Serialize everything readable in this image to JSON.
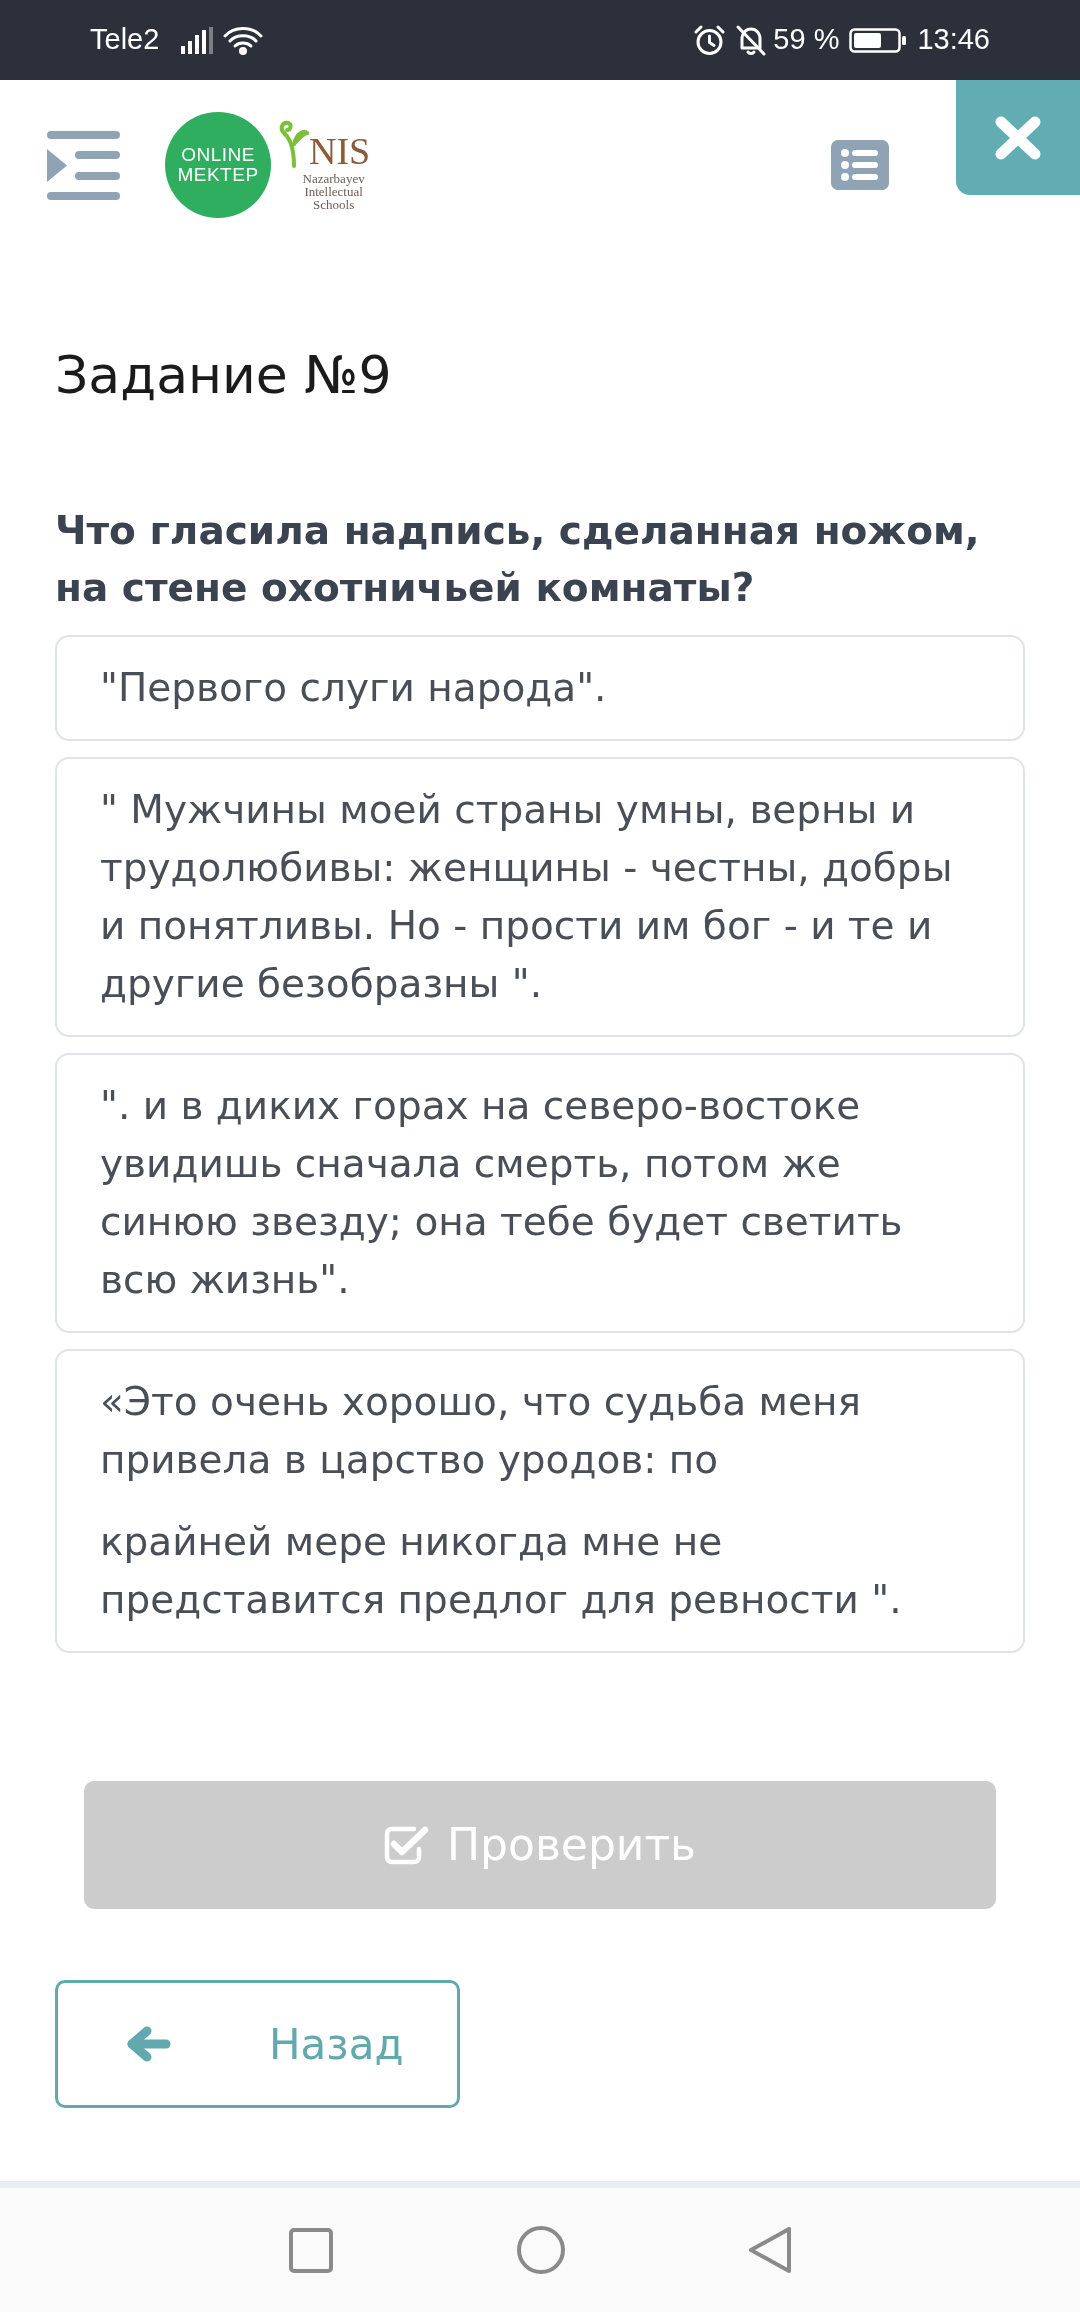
{
  "status_bar": {
    "carrier": "Tele2",
    "battery": "59 %",
    "time": "13:46"
  },
  "header": {
    "app_logo": {
      "lines": [
        "ONLINE",
        "MEKTEP"
      ]
    },
    "school_logo": {
      "mark": "NIS",
      "caption": [
        "Nazarbayev",
        "Intellectual",
        "Schools"
      ]
    }
  },
  "task": {
    "title": "Задание №9",
    "question": "Что гласила надпись, сделанная ножом, на стене охотничьей комнаты?",
    "options": [
      {
        "paragraphs": [
          "\"Первого слуги народа\"."
        ],
        "selected": false
      },
      {
        "paragraphs": [
          "\" Мужчины моей страны умны, верны и трудолюбивы: женщины - честны, добры и понятливы. Но - прости им бог - и те и другие безобразны \"."
        ],
        "selected": false
      },
      {
        "paragraphs": [
          "\". и в диких горах на северо-востоке увидишь сначала смерть, потом же синюю звезду; она тебе будет светить всю жизнь\"."
        ],
        "selected": false
      },
      {
        "paragraphs": [
          "«Это очень хорошо, что судьба меня привела в царство уродов: по",
          "крайней мере никогда мне не представится предлог для ревности \"."
        ],
        "selected": false
      }
    ]
  },
  "check_button": {
    "label": "Проверить",
    "disabled": true
  },
  "back_button": {
    "label": "Назад"
  }
}
